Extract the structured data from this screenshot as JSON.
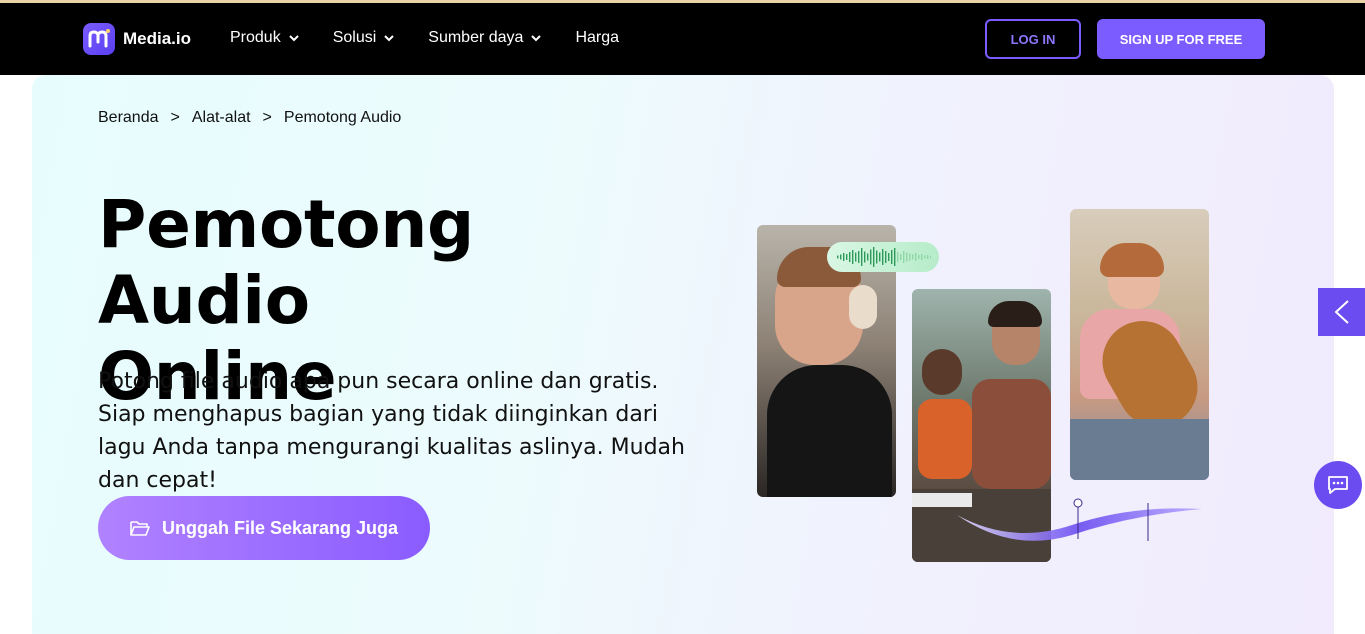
{
  "brand": {
    "name": "Media.io",
    "accent": "#7b5cff",
    "logo_icon": "media-io-logo"
  },
  "nav": {
    "items": [
      {
        "label": "Produk",
        "has_dropdown": true
      },
      {
        "label": "Solusi",
        "has_dropdown": true
      },
      {
        "label": "Sumber daya",
        "has_dropdown": true
      },
      {
        "label": "Harga",
        "has_dropdown": false
      }
    ],
    "login_label": "LOG IN",
    "signup_label": "SIGN UP FOR FREE"
  },
  "breadcrumb": {
    "items": [
      "Beranda",
      "Alat-alat",
      "Pemotong Audio"
    ],
    "separator": ">"
  },
  "hero": {
    "title_line1": "Pemotong Audio",
    "title_line2": "Online",
    "description": "Potong file audio apa pun secara online dan gratis. Siap menghapus bagian yang tidak diinginkan dari lagu Anda tanpa mengurangi kualitas aslinya. Mudah dan cepat!",
    "cta_label": "Unggah File Sekarang Juga",
    "cta_icon": "folder-open-icon"
  },
  "widgets": {
    "side_tab_icon": "chevron-left-icon",
    "chat_icon": "chat-icon"
  }
}
